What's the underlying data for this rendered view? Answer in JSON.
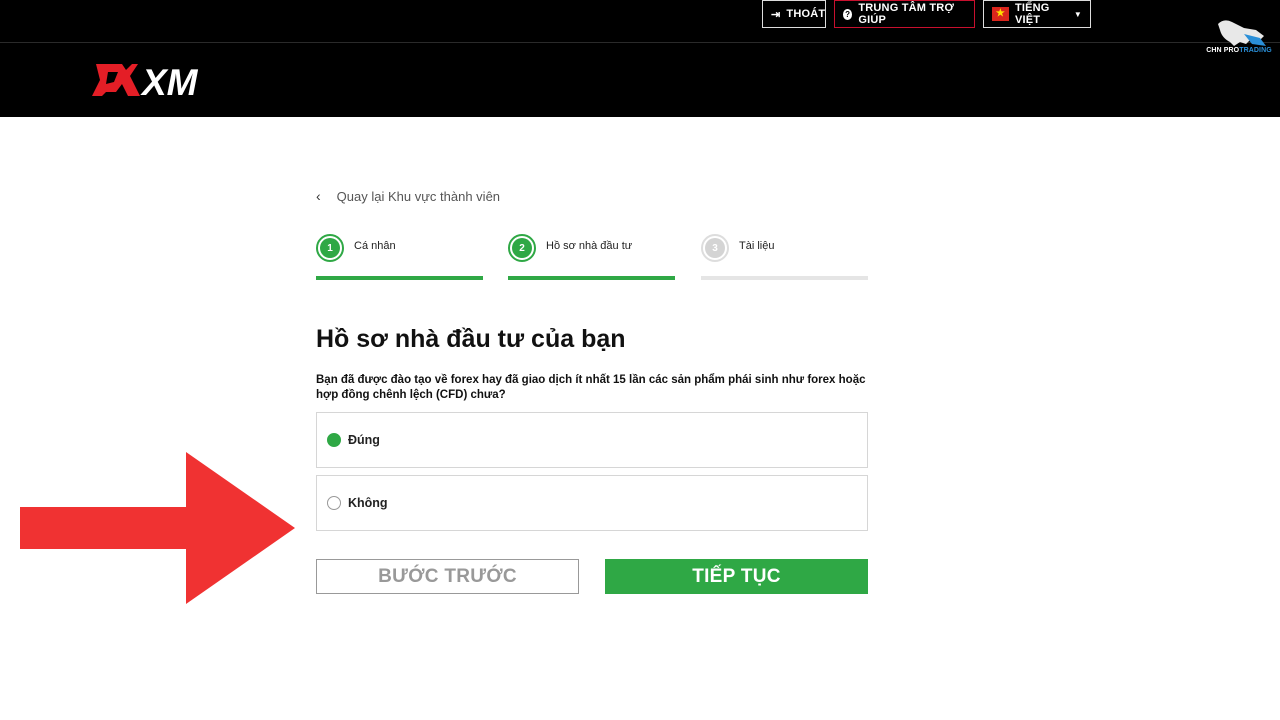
{
  "header": {
    "logo_text": "XM",
    "logout_label": "THOÁT",
    "help_label": "TRUNG TÂM TRỢ GIÚP",
    "language_label": "TIẾNG VIỆT",
    "watermark_text_a": "CHN PRO",
    "watermark_text_b": "TRADING"
  },
  "back_link": "Quay lại Khu vực thành viên",
  "steps": [
    {
      "number": "1",
      "label": "Cá nhân",
      "state": "done"
    },
    {
      "number": "2",
      "label": "Hồ sơ nhà đầu tư",
      "state": "active"
    },
    {
      "number": "3",
      "label": "Tài liệu",
      "state": "inactive"
    }
  ],
  "form": {
    "title": "Hồ sơ nhà đầu tư của bạn",
    "question": "Bạn đã được đào tạo về forex hay đã giao dịch ít nhất 15 lần các sản phẩm phái sinh như forex hoặc hợp đồng chênh lệch (CFD) chưa?",
    "options": [
      {
        "label": "Đúng",
        "selected": true
      },
      {
        "label": "Không",
        "selected": false
      }
    ],
    "prev_label": "BƯỚC TRƯỚC",
    "next_label": "TIẾP TỤC"
  },
  "colors": {
    "accent_green": "#2fa845",
    "header_bg": "#000000",
    "arrow_red": "#f03232",
    "help_border": "#c8102e"
  }
}
